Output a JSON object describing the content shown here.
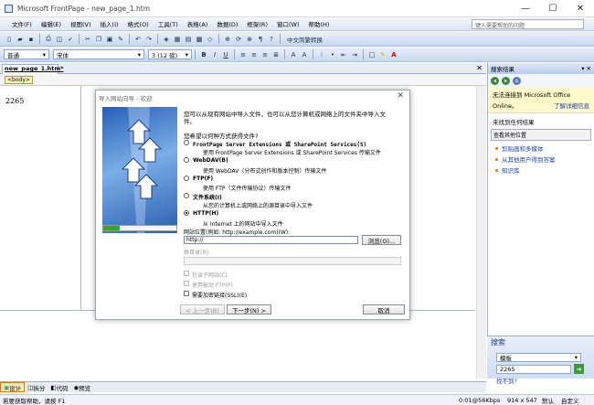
{
  "window": {
    "title": "Microsoft FrontPage - new_page_1.htm",
    "minimize": "—",
    "maximize": "☐",
    "close": "✕"
  },
  "menu": [
    "文件(F)",
    "编辑(E)",
    "视图(V)",
    "插入(I)",
    "格式(O)",
    "工具(T)",
    "表格(A)",
    "数据(D)",
    "框架(R)",
    "窗口(W)",
    "帮助(H)"
  ],
  "help_placeholder": "键入需要帮助的问题",
  "toolbar": {
    "lang_button": "中文简繁转换",
    "style": "普通",
    "font": "宋体",
    "size": "3 (12 磅)"
  },
  "doc_tab": "new_page_1.htm*",
  "tag": "<body>",
  "editor_text": "2265",
  "view_tabs": [
    "设计",
    "拆分",
    "代码",
    "预览"
  ],
  "status": {
    "left": "若要获取帮助，请按 F1",
    "time": "0:01@56Kbps",
    "size": "914 x 547",
    "mode1": "默认",
    "mode2": "自定义"
  },
  "taskpane": {
    "title": "搜索结果",
    "line1": "无法连接到 Microsoft Office",
    "line2": "Online。",
    "more_info": "了解详细信息",
    "line3": "未找到任何结果",
    "suggest": "查看其他位置",
    "links": [
      "剪贴画和多媒体",
      "从其他用户得到答案",
      "知识库"
    ],
    "search_title": "搜索",
    "search_scope": "模板",
    "search_value": "2265",
    "cant_find": "找不到?"
  },
  "dialog": {
    "title": "导入网站向导 - 欢迎",
    "intro1": "您可以从现有网站中导入文件，也可以从您计算机或网络上的文件夹中导入文",
    "intro2": "件。",
    "question": "您希望以何种方式获得文件?",
    "options": [
      {
        "label": "FrontPage Server Extensions 或 SharePoint Services(S)",
        "desc": "使用 FrontPage Server Extensions 或 SharePoint Services 传输文件"
      },
      {
        "label": "WebDAV(B)",
        "desc": "使用 WebDAV（分布式创作和版本控制）传输文件"
      },
      {
        "label": "FTP(F)",
        "desc": "使用 FTP（文件传输协议）传输文件"
      },
      {
        "label": "文件系统(I)",
        "desc": "从您的计算机上或网络上的源目录中导入文件"
      },
      {
        "label": "HTTP(H)",
        "desc": "从 Internet 上的网站中导入文件"
      }
    ],
    "location_label": "网站位置(例如: http://example.com)(W):",
    "location_value": "http://",
    "browse": "浏览(O)...",
    "root_label": "根目录(R):",
    "include_sub": "包含子网站(C)",
    "passive_ftp": "使用被动 FTP(P)",
    "ssl": "需要加密链接(SSL)(E)",
    "back": "< 上一步(B)",
    "next": "下一步(N) >",
    "cancel": "取消",
    "progress": 0.22
  }
}
